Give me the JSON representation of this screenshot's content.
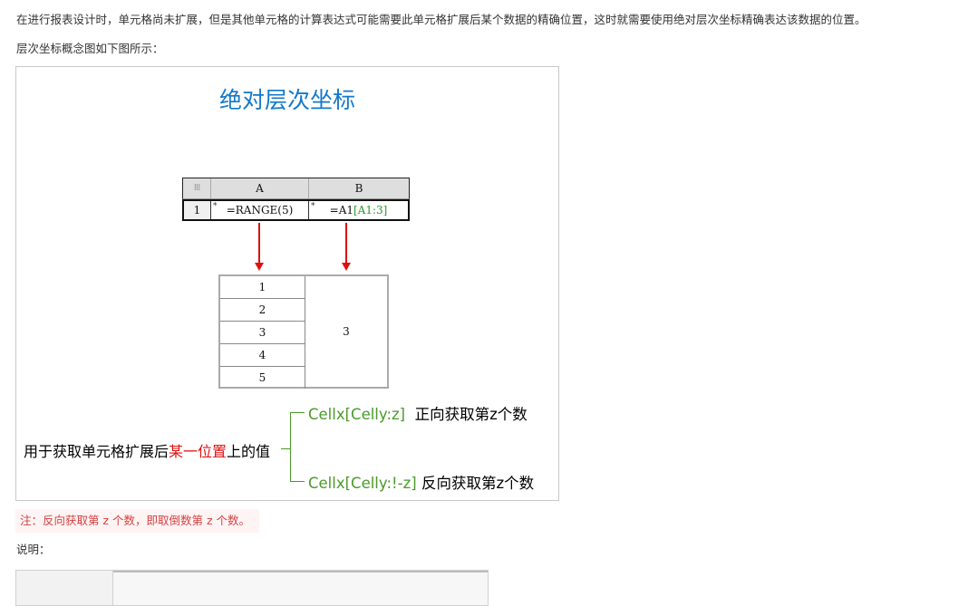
{
  "paragraphs": {
    "intro": "在进行报表设计时，单元格尚未扩展，但是其他单元格的计算表达式可能需要此单元格扩展后某个数据的精确位置，这时就需要使用绝对层次坐标精确表达该数据的位置。",
    "figure_caption": "层次坐标概念图如下图所示：",
    "explanation": "说明："
  },
  "figure": {
    "title": "绝对层次坐标",
    "spreadsheet": {
      "corner": "⁝⁝⁝",
      "col_a": "A",
      "col_b": "B",
      "row_num": "1",
      "cell_a_formula": "=RANGE(5)",
      "cell_b_prefix": "=A1",
      "cell_b_bracket": "[A1:3]"
    },
    "result_values": [
      "1",
      "2",
      "3",
      "4",
      "5"
    ],
    "result_b_value": "3",
    "annotation": {
      "main_before": "用于获取单元格扩展后",
      "main_highlight": "某一位置",
      "main_after": "上的值",
      "line1_expr": "Cellx[Celly:z]",
      "line1_text": "正向获取第z个数",
      "line2_expr": "Cellx[Celly:!-z]",
      "line2_text": "反向获取第z个数"
    },
    "colors": {
      "title": "#1478c8",
      "arrow": "#e01010",
      "green": "#4a9a2a",
      "highlight": "#e01010"
    }
  },
  "note": "注：反向获取第 z 个数，即取倒数第 z 个数。"
}
